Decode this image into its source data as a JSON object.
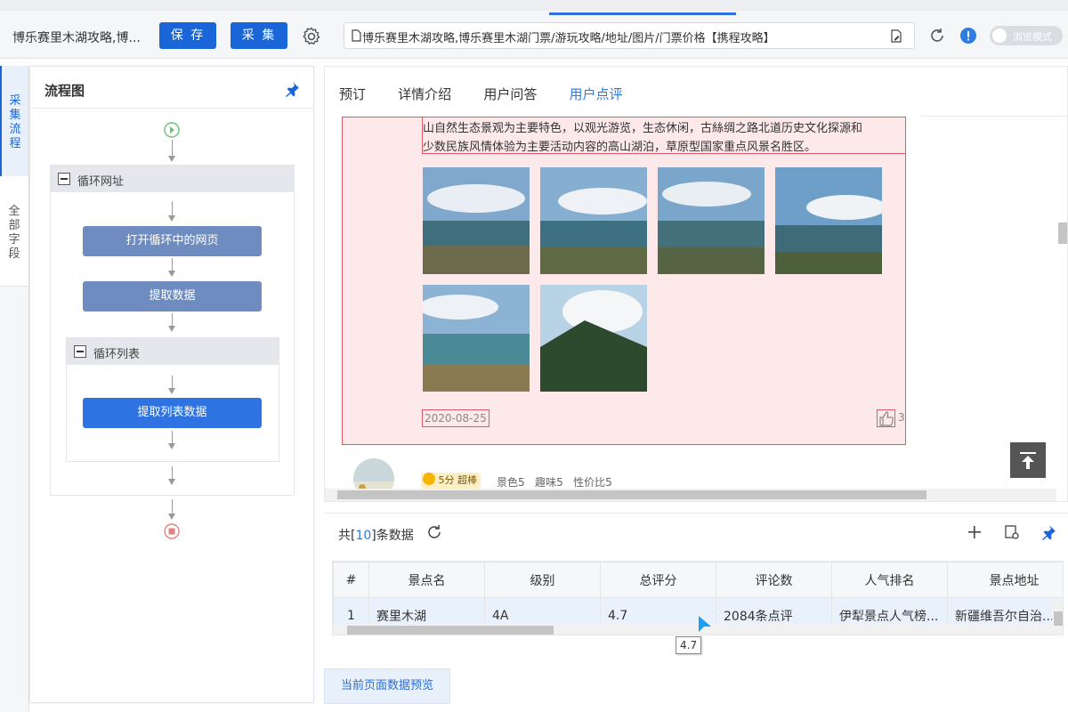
{
  "topbar": {
    "window_title": "博乐赛里木湖攻略,博...",
    "save_label": "保 存",
    "collect_label": "采 集",
    "url": "博乐赛里木湖攻略,博乐赛里木湖门票/游玩攻略/地址/图片/门票价格【携程攻略】",
    "mode_label": "浏览模式"
  },
  "side_tabs": {
    "collect_flow": "采集流程",
    "all_fields": "全部字段"
  },
  "flow": {
    "title": "流程图",
    "loop_url": "循环网址",
    "open_page": "打开循环中的网页",
    "extract_data": "提取数据",
    "loop_list": "循环列表",
    "extract_list": "提取列表数据"
  },
  "content": {
    "tabs": [
      "预订",
      "详情介绍",
      "用户问答",
      "用户点评"
    ],
    "active_tab": 3,
    "review_text_line1": "山自然生态景观为主要特色，以观光游览，生态休闲，古絲绸之路北道历史文化探源和",
    "review_text_line2": "少数民族风情体验为主要活动内容的高山湖泊，草原型国家重点风景名胜区。",
    "review_date": "2020-08-25",
    "like_count": "3",
    "next_score": "5分 超棒",
    "next_sub_scores": "景色5   趣味5   性价比5"
  },
  "preview": {
    "count_prefix": "共[",
    "count_value": "10",
    "count_suffix": "]条数据",
    "columns": [
      "#",
      "景点名",
      "级别",
      "总评分",
      "评论数",
      "人气排名",
      "景点地址"
    ],
    "rows": [
      [
        "1",
        "赛里木湖",
        "4A",
        "4.7",
        "2084条点评",
        "伊犁景点人气榜...",
        "新疆维吾尔自治..."
      ]
    ],
    "tooltip": "4.7",
    "footer_tab": "当前页面数据预览"
  },
  "colors": {
    "accent": "#1a66d9",
    "highlight_border": "#e05a66",
    "highlight_fill": "#fde8ea"
  }
}
